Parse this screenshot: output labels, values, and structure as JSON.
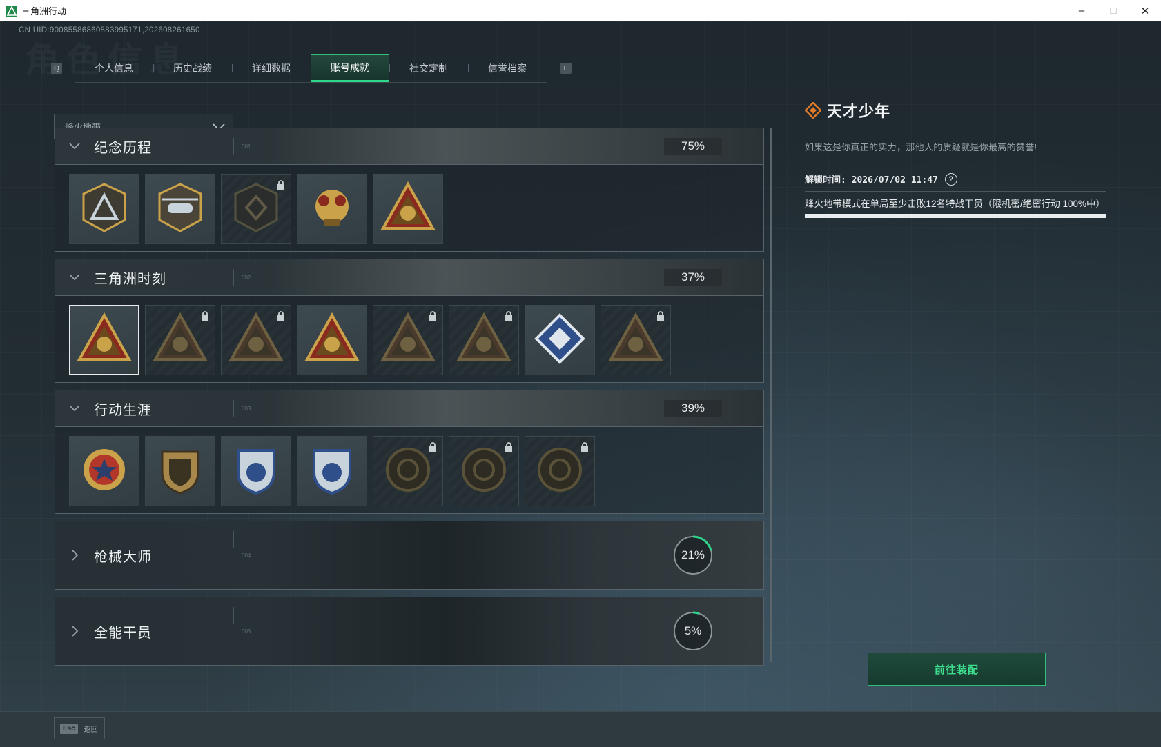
{
  "window": {
    "title": "三角洲行动"
  },
  "uid_text": "CN UID:9008558686088399517​1,202608261650",
  "ghost_title": "角色信息",
  "tabs": {
    "left_key": "Q",
    "right_key": "E",
    "items": [
      {
        "label": "个人信息",
        "active": false
      },
      {
        "label": "历史战绩",
        "active": false
      },
      {
        "label": "详细数据",
        "active": false
      },
      {
        "label": "账号成就",
        "active": true
      },
      {
        "label": "社交定制",
        "active": false
      },
      {
        "label": "信誉档案",
        "active": false
      }
    ]
  },
  "mode_select": {
    "value": "烽火地带"
  },
  "sections": [
    {
      "title": "纪念历程",
      "code": "001",
      "progress": "75%",
      "expanded": true,
      "badges": [
        {
          "icon": "delta-shield-badge-icon",
          "locked": false
        },
        {
          "icon": "helicopter-badge-icon",
          "locked": false
        },
        {
          "icon": "hex-emblem-badge-icon",
          "locked": true
        },
        {
          "icon": "gold-cluster-badge-icon",
          "locked": false
        },
        {
          "icon": "egg-triangle-badge-icon",
          "locked": false
        }
      ]
    },
    {
      "title": "三角洲时刻",
      "code": "002",
      "progress": "37%",
      "expanded": true,
      "badges": [
        {
          "icon": "backpack-triangle-badge-icon",
          "locked": false,
          "selected": true
        },
        {
          "icon": "runner-triangle-badge-icon",
          "locked": true
        },
        {
          "icon": "gem-triangle-badge-icon",
          "locked": true
        },
        {
          "icon": "squad-triangle-badge-icon",
          "locked": false
        },
        {
          "icon": "crowd-triangle-badge-icon",
          "locked": true
        },
        {
          "icon": "fish-triangle-badge-icon",
          "locked": true
        },
        {
          "icon": "blue-diamond-badge-icon",
          "locked": false
        },
        {
          "icon": "dragon-triangle-badge-icon",
          "locked": true
        }
      ]
    },
    {
      "title": "行动生涯",
      "code": "003",
      "progress": "39%",
      "expanded": true,
      "badges": [
        {
          "icon": "star-medal-badge-icon",
          "locked": false
        },
        {
          "icon": "shield-crest-badge-icon",
          "locked": false
        },
        {
          "icon": "silver-crest-badge-icon",
          "locked": false
        },
        {
          "icon": "silver-diamond-crest-badge-icon",
          "locked": false
        },
        {
          "icon": "shell-medal-badge-icon",
          "locked": true
        },
        {
          "icon": "skull-medal-badge-icon",
          "locked": true
        },
        {
          "icon": "eye-medal-badge-icon",
          "locked": true
        }
      ]
    },
    {
      "title": "枪械大师",
      "code": "004",
      "progress": "21%",
      "progress_value": 0.21,
      "expanded": false
    },
    {
      "title": "全能干员",
      "code": "005",
      "progress": "5%",
      "progress_value": 0.05,
      "expanded": false
    }
  ],
  "detail": {
    "title": "天才少年",
    "description": "如果这是你真正的实力，那他人的质疑就是你最高的赞誉!",
    "unlock_time": "解锁时间: 2026/07/02 11:47",
    "condition": "烽火地带模式在单局至少击败12名特战干员（限机密/绝密行动 100%中）",
    "progress_value": 1.0
  },
  "equip_button": "前往装配",
  "back": {
    "key": "Esc",
    "label": "返回"
  },
  "colors": {
    "accent": "#2fd68a",
    "gold": "#c9a24a",
    "orange": "#e07a2a"
  }
}
